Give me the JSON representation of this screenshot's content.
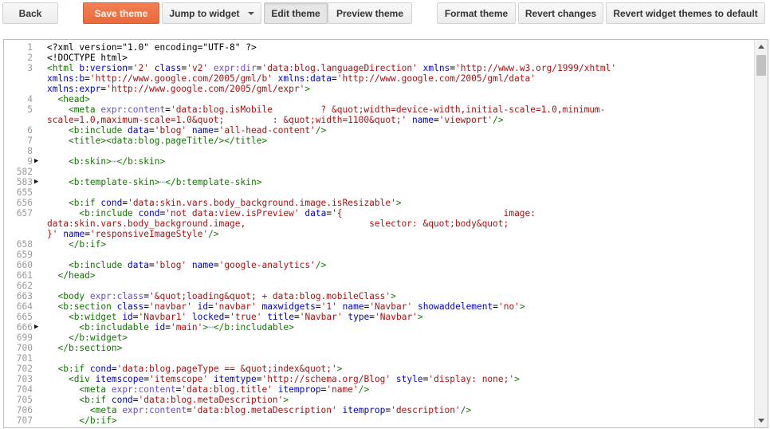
{
  "toolbar": {
    "back": "Back",
    "save_theme": "Save theme",
    "jump_to_widget": "Jump to widget",
    "edit_theme": "Edit theme",
    "preview_theme": "Preview theme",
    "format_theme": "Format theme",
    "revert_changes": "Revert changes",
    "revert_widget_themes": "Revert widget themes to default"
  },
  "colors": {
    "primary_button": "#ef7445",
    "tag": "#117700",
    "attribute": "#0000cc",
    "string": "#aa1111"
  },
  "code_lines": [
    {
      "n": "1",
      "fold": "",
      "s": [
        [
          "text",
          "<?xml version=\"1.0\" encoding=\"UTF-8\" ?>"
        ]
      ]
    },
    {
      "n": "2",
      "fold": "",
      "s": [
        [
          "text",
          "<!DOCTYPE html>"
        ]
      ]
    },
    {
      "n": "3",
      "fold": "",
      "s": [
        [
          "tag",
          "<html "
        ],
        [
          "attr",
          "b:version"
        ],
        [
          "text",
          "="
        ],
        [
          "str",
          "'2'"
        ],
        [
          "text",
          " "
        ],
        [
          "attr",
          "class"
        ],
        [
          "text",
          "="
        ],
        [
          "str",
          "'v2'"
        ],
        [
          "text",
          " "
        ],
        [
          "expr",
          "expr:dir"
        ],
        [
          "text",
          "="
        ],
        [
          "str",
          "'data:blog.languageDirection'"
        ],
        [
          "text",
          " "
        ],
        [
          "attr",
          "xmlns"
        ],
        [
          "text",
          "="
        ],
        [
          "str",
          "'http://www.w3.org/1999/xhtml'"
        ]
      ]
    },
    {
      "n": "",
      "fold": "",
      "s": [
        [
          "attr",
          "xmlns:b"
        ],
        [
          "text",
          "="
        ],
        [
          "str",
          "'http://www.google.com/2005/gml/b'"
        ],
        [
          "text",
          " "
        ],
        [
          "attr",
          "xmlns:data"
        ],
        [
          "text",
          "="
        ],
        [
          "str",
          "'http://www.google.com/2005/gml/data'"
        ]
      ]
    },
    {
      "n": "",
      "fold": "",
      "s": [
        [
          "attr",
          "xmlns:expr"
        ],
        [
          "text",
          "="
        ],
        [
          "str",
          "'http://www.google.com/2005/gml/expr'"
        ],
        [
          "tag",
          ">"
        ]
      ]
    },
    {
      "n": "4",
      "fold": "",
      "s": [
        [
          "text",
          "  "
        ],
        [
          "tag",
          "<head>"
        ]
      ]
    },
    {
      "n": "5",
      "fold": "",
      "s": [
        [
          "text",
          "    "
        ],
        [
          "tag",
          "<meta "
        ],
        [
          "expr",
          "expr:content"
        ],
        [
          "text",
          "="
        ],
        [
          "str",
          "'data:blog.isMobile         ? &quot;width=device-width,initial-scale=1.0,minimum-"
        ]
      ]
    },
    {
      "n": "",
      "fold": "",
      "s": [
        [
          "str",
          "scale=1.0,maximum-scale=1.0&quot;         : &quot;width=1100&quot;'"
        ],
        [
          "text",
          " "
        ],
        [
          "attr",
          "name"
        ],
        [
          "text",
          "="
        ],
        [
          "str",
          "'viewport'"
        ],
        [
          "tag",
          "/>"
        ]
      ]
    },
    {
      "n": "6",
      "fold": "",
      "s": [
        [
          "text",
          "    "
        ],
        [
          "tag",
          "<b:include "
        ],
        [
          "attr",
          "data"
        ],
        [
          "text",
          "="
        ],
        [
          "str",
          "'blog'"
        ],
        [
          "text",
          " "
        ],
        [
          "attr",
          "name"
        ],
        [
          "text",
          "="
        ],
        [
          "str",
          "'all-head-content'"
        ],
        [
          "tag",
          "/>"
        ]
      ]
    },
    {
      "n": "7",
      "fold": "",
      "s": [
        [
          "text",
          "    "
        ],
        [
          "tag",
          "<title>"
        ],
        [
          "tag",
          "<data:blog.pageTitle/>"
        ],
        [
          "tag",
          "</title>"
        ]
      ]
    },
    {
      "n": "8",
      "fold": "",
      "s": []
    },
    {
      "n": "9",
      "fold": "▶",
      "s": [
        [
          "text",
          "    "
        ],
        [
          "tag",
          "<b:skin>"
        ],
        [
          "fold",
          "⋯"
        ],
        [
          "tag",
          "</b:skin>"
        ]
      ]
    },
    {
      "n": "582",
      "fold": "",
      "s": []
    },
    {
      "n": "583",
      "fold": "▶",
      "s": [
        [
          "text",
          "    "
        ],
        [
          "tag",
          "<b:template-skin>"
        ],
        [
          "fold",
          "⋯"
        ],
        [
          "tag",
          "</b:template-skin>"
        ]
      ]
    },
    {
      "n": "655",
      "fold": "",
      "s": []
    },
    {
      "n": "656",
      "fold": "",
      "s": [
        [
          "text",
          "    "
        ],
        [
          "tag",
          "<b:if "
        ],
        [
          "attr",
          "cond"
        ],
        [
          "text",
          "="
        ],
        [
          "str",
          "'data:skin.vars.body_background.image.isResizable'"
        ],
        [
          "tag",
          ">"
        ]
      ]
    },
    {
      "n": "657",
      "fold": "",
      "s": [
        [
          "text",
          "      "
        ],
        [
          "tag",
          "<b:include "
        ],
        [
          "attr",
          "cond"
        ],
        [
          "text",
          "="
        ],
        [
          "str",
          "'not data:view.isPreview'"
        ],
        [
          "text",
          " "
        ],
        [
          "attr",
          "data"
        ],
        [
          "text",
          "="
        ],
        [
          "str",
          "'{                              image:"
        ]
      ]
    },
    {
      "n": "",
      "fold": "",
      "s": [
        [
          "str",
          "data:skin.vars.body_background.image,                       selector: &quot;body&quot;"
        ]
      ]
    },
    {
      "n": "",
      "fold": "",
      "s": [
        [
          "str",
          "}'"
        ],
        [
          "text",
          " "
        ],
        [
          "attr",
          "name"
        ],
        [
          "text",
          "="
        ],
        [
          "str",
          "'responsiveImageStyle'"
        ],
        [
          "tag",
          "/>"
        ]
      ]
    },
    {
      "n": "658",
      "fold": "",
      "s": [
        [
          "text",
          "    "
        ],
        [
          "tag",
          "</b:if>"
        ]
      ]
    },
    {
      "n": "659",
      "fold": "",
      "s": []
    },
    {
      "n": "660",
      "fold": "",
      "s": [
        [
          "text",
          "    "
        ],
        [
          "tag",
          "<b:include "
        ],
        [
          "attr",
          "data"
        ],
        [
          "text",
          "="
        ],
        [
          "str",
          "'blog'"
        ],
        [
          "text",
          " "
        ],
        [
          "attr",
          "name"
        ],
        [
          "text",
          "="
        ],
        [
          "str",
          "'google-analytics'"
        ],
        [
          "tag",
          "/>"
        ]
      ]
    },
    {
      "n": "661",
      "fold": "",
      "s": [
        [
          "text",
          "  "
        ],
        [
          "tag",
          "</head>"
        ]
      ]
    },
    {
      "n": "662",
      "fold": "",
      "s": []
    },
    {
      "n": "663",
      "fold": "",
      "s": [
        [
          "text",
          "  "
        ],
        [
          "tag",
          "<body "
        ],
        [
          "expr",
          "expr:class"
        ],
        [
          "text",
          "="
        ],
        [
          "str",
          "'&quot;loading&quot; + data:blog.mobileClass'"
        ],
        [
          "tag",
          ">"
        ]
      ]
    },
    {
      "n": "664",
      "fold": "",
      "s": [
        [
          "text",
          "  "
        ],
        [
          "tag",
          "<b:section "
        ],
        [
          "attr",
          "class"
        ],
        [
          "text",
          "="
        ],
        [
          "str",
          "'navbar'"
        ],
        [
          "text",
          " "
        ],
        [
          "attr",
          "id"
        ],
        [
          "text",
          "="
        ],
        [
          "str",
          "'navbar'"
        ],
        [
          "text",
          " "
        ],
        [
          "attr",
          "maxwidgets"
        ],
        [
          "text",
          "="
        ],
        [
          "str",
          "'1'"
        ],
        [
          "text",
          " "
        ],
        [
          "attr",
          "name"
        ],
        [
          "text",
          "="
        ],
        [
          "str",
          "'Navbar'"
        ],
        [
          "text",
          " "
        ],
        [
          "attr",
          "showaddelement"
        ],
        [
          "text",
          "="
        ],
        [
          "str",
          "'no'"
        ],
        [
          "tag",
          ">"
        ]
      ]
    },
    {
      "n": "665",
      "fold": "",
      "s": [
        [
          "text",
          "    "
        ],
        [
          "tag",
          "<b:widget "
        ],
        [
          "attr",
          "id"
        ],
        [
          "text",
          "="
        ],
        [
          "str",
          "'Navbar1'"
        ],
        [
          "text",
          " "
        ],
        [
          "attr",
          "locked"
        ],
        [
          "text",
          "="
        ],
        [
          "str",
          "'true'"
        ],
        [
          "text",
          " "
        ],
        [
          "attr",
          "title"
        ],
        [
          "text",
          "="
        ],
        [
          "str",
          "'Navbar'"
        ],
        [
          "text",
          " "
        ],
        [
          "attr",
          "type"
        ],
        [
          "text",
          "="
        ],
        [
          "str",
          "'Navbar'"
        ],
        [
          "tag",
          ">"
        ]
      ]
    },
    {
      "n": "666",
      "fold": "▶",
      "s": [
        [
          "text",
          "      "
        ],
        [
          "tag",
          "<b:includable "
        ],
        [
          "attr",
          "id"
        ],
        [
          "text",
          "="
        ],
        [
          "str",
          "'main'"
        ],
        [
          "tag",
          ">"
        ],
        [
          "fold",
          "⋯"
        ],
        [
          "tag",
          "</b:includable>"
        ]
      ]
    },
    {
      "n": "699",
      "fold": "",
      "s": [
        [
          "text",
          "    "
        ],
        [
          "tag",
          "</b:widget>"
        ]
      ]
    },
    {
      "n": "700",
      "fold": "",
      "s": [
        [
          "text",
          "  "
        ],
        [
          "tag",
          "</b:section>"
        ]
      ]
    },
    {
      "n": "701",
      "fold": "",
      "s": []
    },
    {
      "n": "702",
      "fold": "",
      "s": [
        [
          "text",
          "  "
        ],
        [
          "tag",
          "<b:if "
        ],
        [
          "attr",
          "cond"
        ],
        [
          "text",
          "="
        ],
        [
          "str",
          "'data:blog.pageType == &quot;index&quot;'"
        ],
        [
          "tag",
          ">"
        ]
      ]
    },
    {
      "n": "703",
      "fold": "",
      "s": [
        [
          "text",
          "    "
        ],
        [
          "tag",
          "<div "
        ],
        [
          "attr",
          "itemscope"
        ],
        [
          "text",
          "="
        ],
        [
          "str",
          "'itemscope'"
        ],
        [
          "text",
          " "
        ],
        [
          "attr",
          "itemtype"
        ],
        [
          "text",
          "="
        ],
        [
          "str",
          "'http://schema.org/Blog'"
        ],
        [
          "text",
          " "
        ],
        [
          "attr",
          "style"
        ],
        [
          "text",
          "="
        ],
        [
          "str",
          "'display: none;'"
        ],
        [
          "tag",
          ">"
        ]
      ]
    },
    {
      "n": "704",
      "fold": "",
      "s": [
        [
          "text",
          "      "
        ],
        [
          "tag",
          "<meta "
        ],
        [
          "expr",
          "expr:content"
        ],
        [
          "text",
          "="
        ],
        [
          "str",
          "'data:blog.title'"
        ],
        [
          "text",
          " "
        ],
        [
          "attr",
          "itemprop"
        ],
        [
          "text",
          "="
        ],
        [
          "str",
          "'name'"
        ],
        [
          "tag",
          "/>"
        ]
      ]
    },
    {
      "n": "705",
      "fold": "",
      "s": [
        [
          "text",
          "      "
        ],
        [
          "tag",
          "<b:if "
        ],
        [
          "attr",
          "cond"
        ],
        [
          "text",
          "="
        ],
        [
          "str",
          "'data:blog.metaDescription'"
        ],
        [
          "tag",
          ">"
        ]
      ]
    },
    {
      "n": "706",
      "fold": "",
      "s": [
        [
          "text",
          "        "
        ],
        [
          "tag",
          "<meta "
        ],
        [
          "expr",
          "expr:content"
        ],
        [
          "text",
          "="
        ],
        [
          "str",
          "'data:blog.metaDescription'"
        ],
        [
          "text",
          " "
        ],
        [
          "attr",
          "itemprop"
        ],
        [
          "text",
          "="
        ],
        [
          "str",
          "'description'"
        ],
        [
          "tag",
          "/>"
        ]
      ]
    },
    {
      "n": "707",
      "fold": "",
      "s": [
        [
          "text",
          "      "
        ],
        [
          "tag",
          "</b:if>"
        ]
      ]
    }
  ]
}
